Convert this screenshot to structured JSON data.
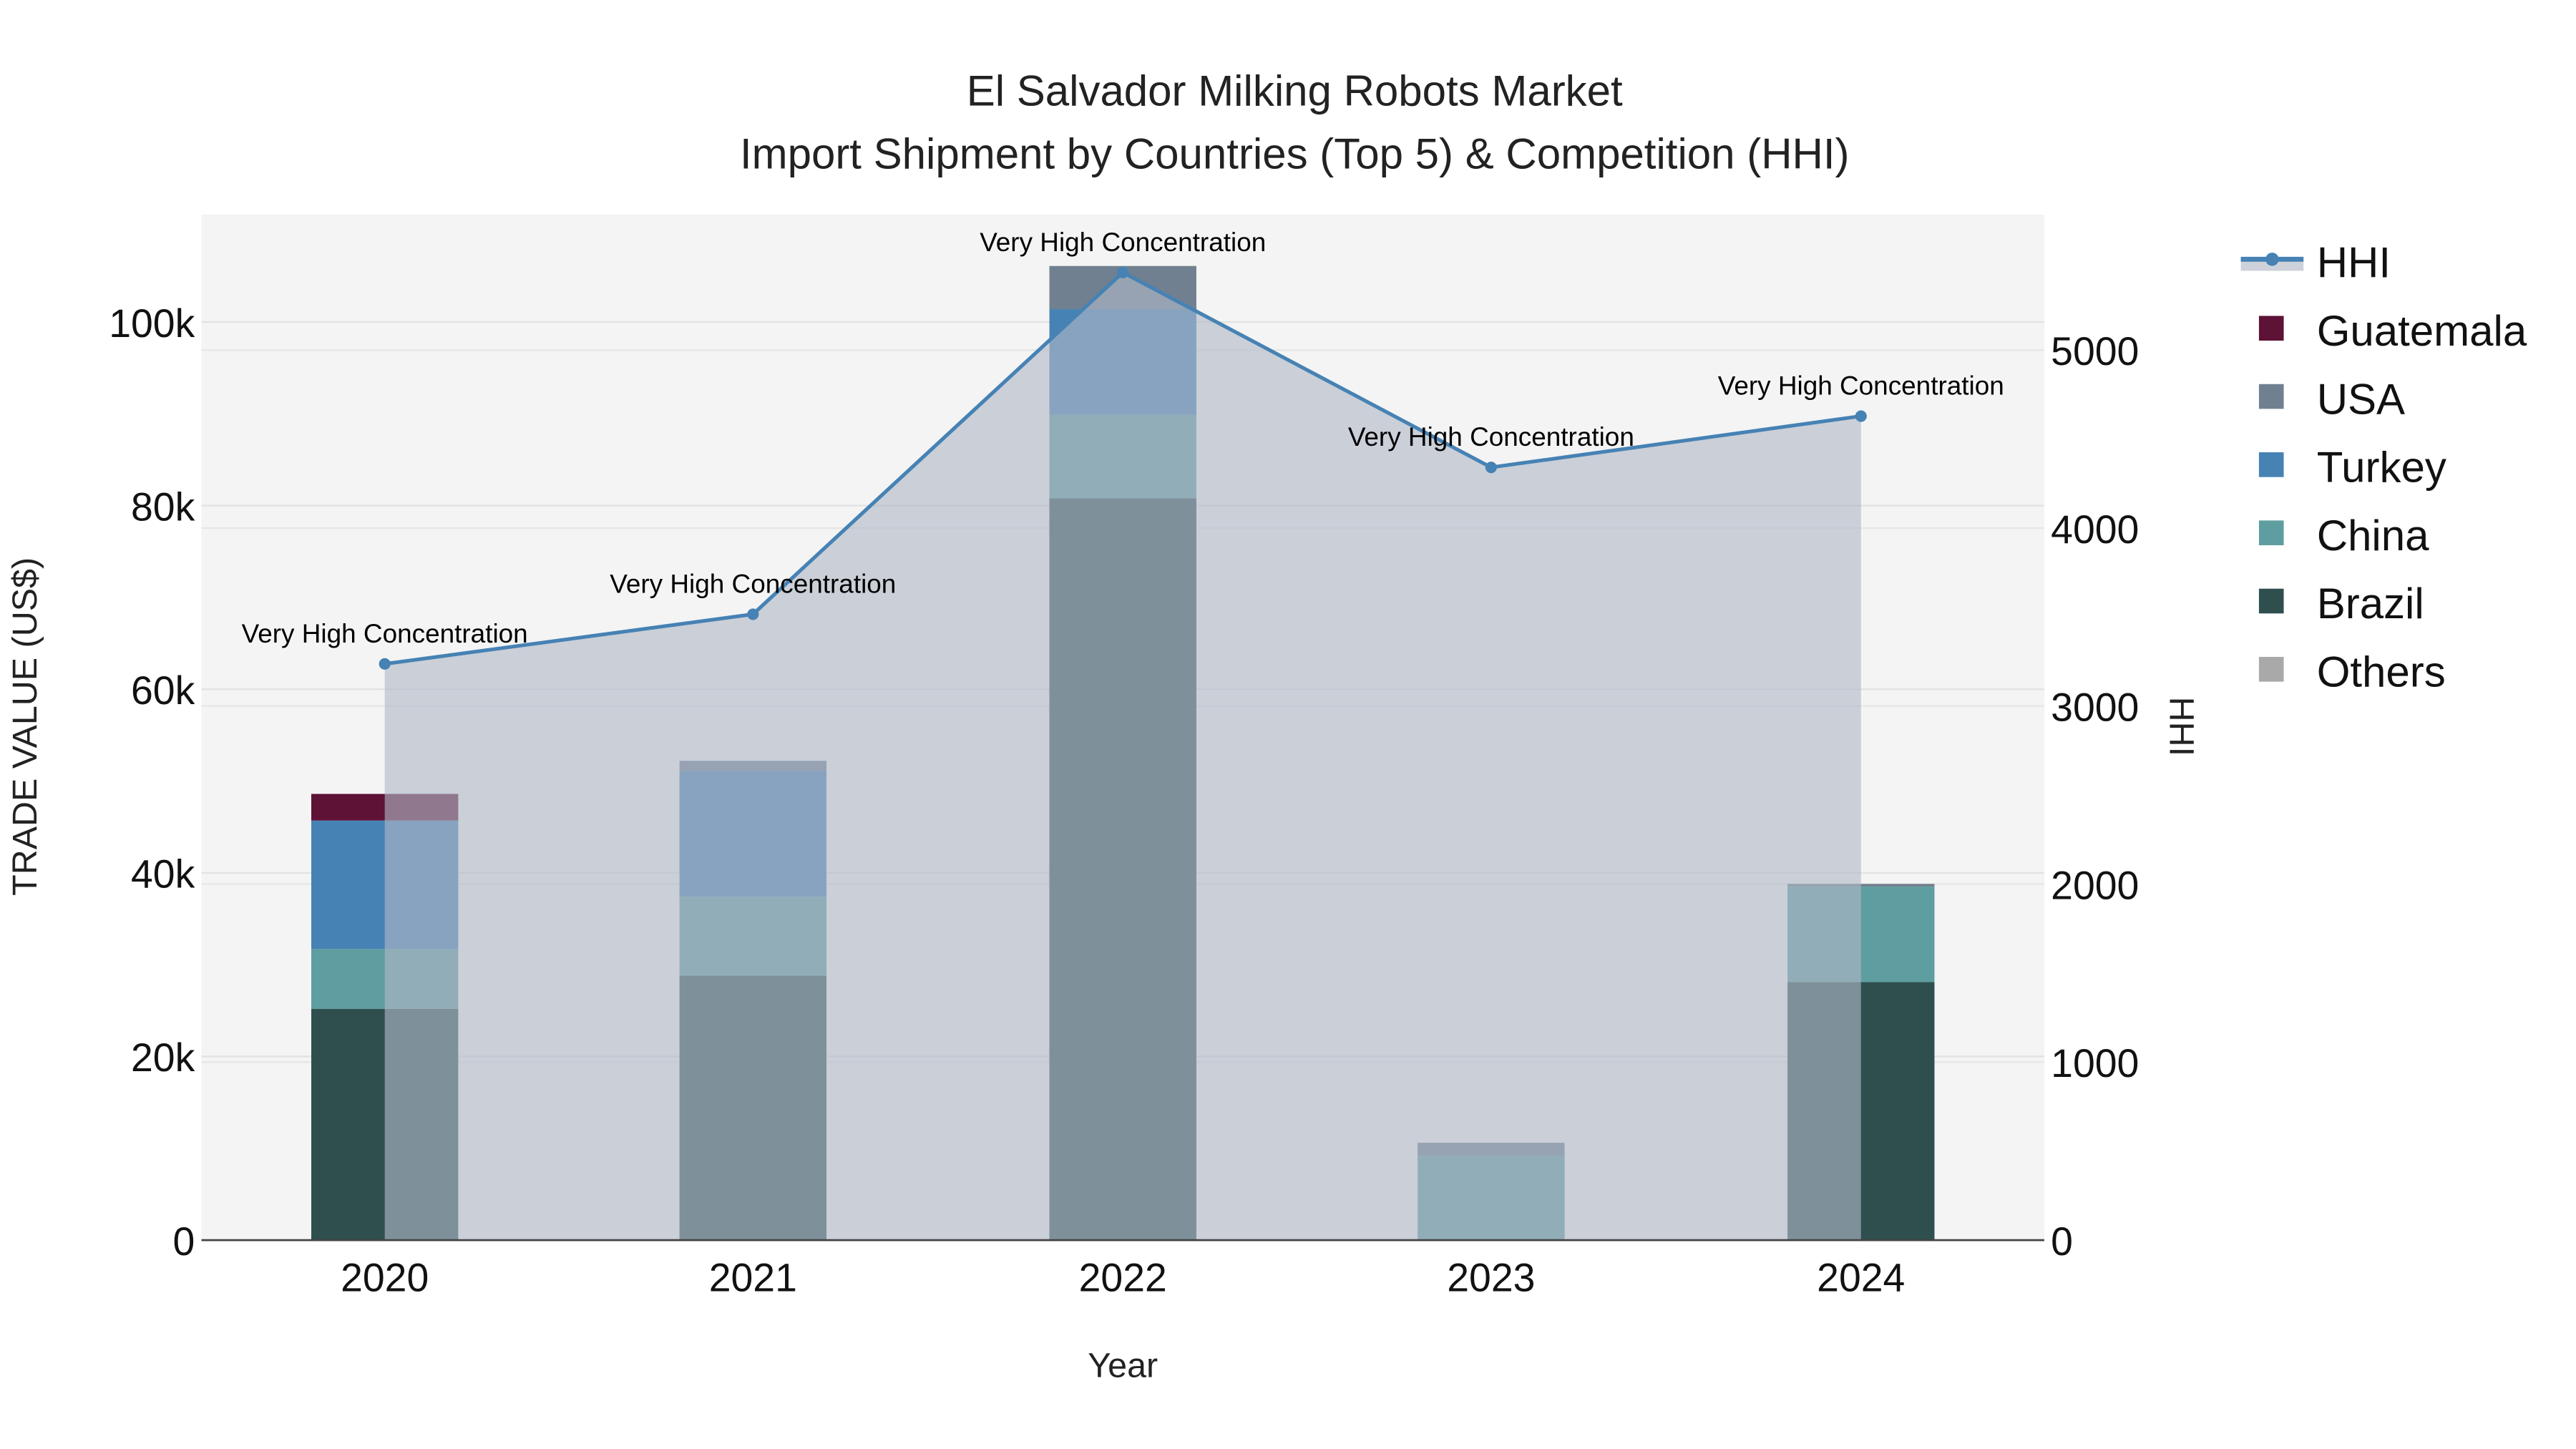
{
  "chart_data": {
    "type": "bar",
    "barmode": "stack",
    "title_line1": "El Salvador Milking Robots Market",
    "title_line2": "Import Shipment by Countries (Top 5) & Competition (HHI)",
    "xlabel": "Year",
    "ylabel": "TRADE VALUE (US$)",
    "y2label": "HHI",
    "categories": [
      "2020",
      "2021",
      "2022",
      "2023",
      "2024"
    ],
    "ylim": [
      0,
      110000
    ],
    "y2lim": [
      0,
      5700
    ],
    "yticks": [
      0,
      20000,
      40000,
      60000,
      80000,
      100000
    ],
    "ytick_labels": [
      "0",
      "20k",
      "40k",
      "60k",
      "80k",
      "100k"
    ],
    "y2ticks": [
      0,
      1000,
      2000,
      3000,
      4000,
      5000
    ],
    "y2tick_labels": [
      "0",
      "1000",
      "2000",
      "3000",
      "4000",
      "5000"
    ],
    "grid": true,
    "legend_position": "right",
    "series": [
      {
        "name": "Brazil",
        "color": "#2f4f4f",
        "values": [
          25200,
          28800,
          80800,
          0,
          28100
        ]
      },
      {
        "name": "China",
        "color": "#5f9ea0",
        "values": [
          6500,
          8600,
          9100,
          9200,
          10400
        ]
      },
      {
        "name": "Turkey",
        "color": "#4682b4",
        "values": [
          14000,
          13700,
          11500,
          0,
          0
        ]
      },
      {
        "name": "USA",
        "color": "#708090",
        "values": [
          0,
          1100,
          4700,
          1400,
          300
        ]
      },
      {
        "name": "Guatemala",
        "color": "#5e1236",
        "values": [
          2900,
          0,
          0,
          0,
          0
        ]
      },
      {
        "name": "Others",
        "color": "#a9a9a9",
        "values": [
          0,
          0,
          0,
          0,
          0
        ]
      }
    ],
    "hhi": {
      "name": "HHI",
      "color": "#4682b4",
      "values": [
        3237,
        3516,
        5436,
        4341,
        4629
      ],
      "annotations": [
        "Very High Concentration",
        "Very High Concentration",
        "Very High Concentration",
        "Very High Concentration",
        "Very High Concentration"
      ]
    },
    "legend_order": [
      "HHI",
      "Guatemala",
      "USA",
      "Turkey",
      "China",
      "Brazil",
      "Others"
    ]
  }
}
